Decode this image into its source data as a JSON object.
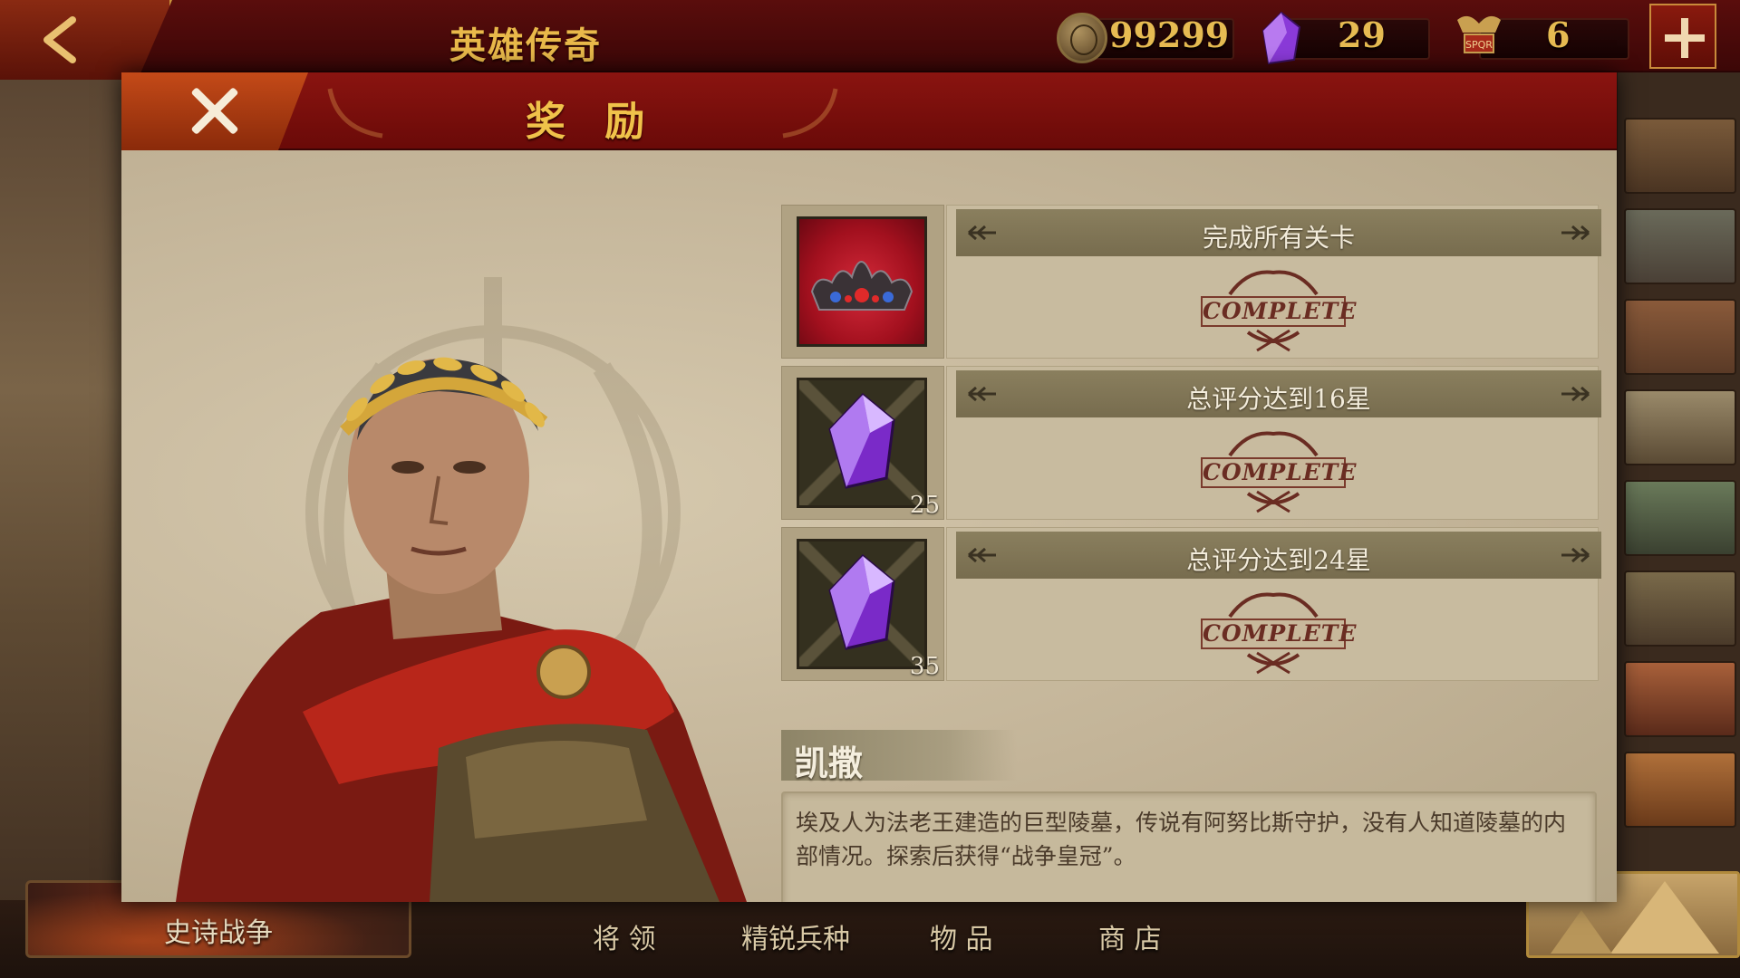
{
  "topbar": {
    "title": "英雄传奇",
    "coins": "99299",
    "gems": "29",
    "spqr_tokens": "6",
    "icons": {
      "back": "back-arrow-icon",
      "coin": "coin-icon",
      "gem": "purple-gem-icon",
      "spqr": "spqr-eagle-icon",
      "add": "plus-icon"
    }
  },
  "dialog": {
    "title": "奖 励",
    "hero_name": "凯撒",
    "description": "埃及人为法老王建造的巨型陵墓，传说有阿努比斯守护，没有人知道陵墓的内部情况。探索后获得“战争皇冠”。",
    "rewards": [
      {
        "task": "完成所有关卡",
        "item_icon": "war-crown-icon",
        "quantity": "",
        "status": "COMPLETE"
      },
      {
        "task": "总评分达到16星",
        "item_icon": "purple-gem-icon",
        "quantity": "25",
        "status": "COMPLETE"
      },
      {
        "task": "总评分达到24星",
        "item_icon": "purple-gem-icon",
        "quantity": "35",
        "status": "COMPLETE"
      }
    ]
  },
  "bottom_nav": {
    "epic_war": "史诗战争",
    "generals": "将 领",
    "elite_troops": "精锐兵种",
    "items": "物 品",
    "shop": "商 店"
  },
  "colors": {
    "header_red": "#6a0a08",
    "gold_text": "#f0c24a",
    "parchment": "#c2b397",
    "stamp_red": "#6a2c22"
  }
}
